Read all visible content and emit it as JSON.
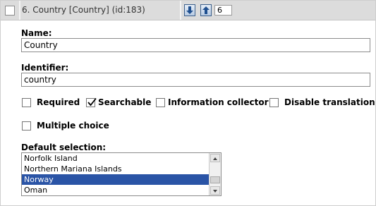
{
  "attribute": {
    "title": "6. Country [Country] (id:183)",
    "priority": "6"
  },
  "name_field": {
    "label": "Name:",
    "value": "Country"
  },
  "identifier_field": {
    "label": "Identifier:",
    "value": "country"
  },
  "options": [
    {
      "label": "Required",
      "checked": false
    },
    {
      "label": "Searchable",
      "checked": true
    },
    {
      "label": "Information collector",
      "checked": false
    },
    {
      "label": "Disable translation",
      "checked": false
    },
    {
      "label": "Multiple choice",
      "checked": false
    }
  ],
  "default_selection": {
    "label": "Default selection:",
    "items": [
      "Norfolk Island",
      "Northern Mariana Islands",
      "Norway",
      "Oman"
    ],
    "selected": "Norway"
  },
  "icons": {
    "move_down": "arrow-down-icon",
    "move_up": "arrow-up-icon"
  },
  "colors": {
    "selection": "#2a54a6",
    "header_bg": "#dcdcdc",
    "button_border": "#3b5f8a"
  }
}
